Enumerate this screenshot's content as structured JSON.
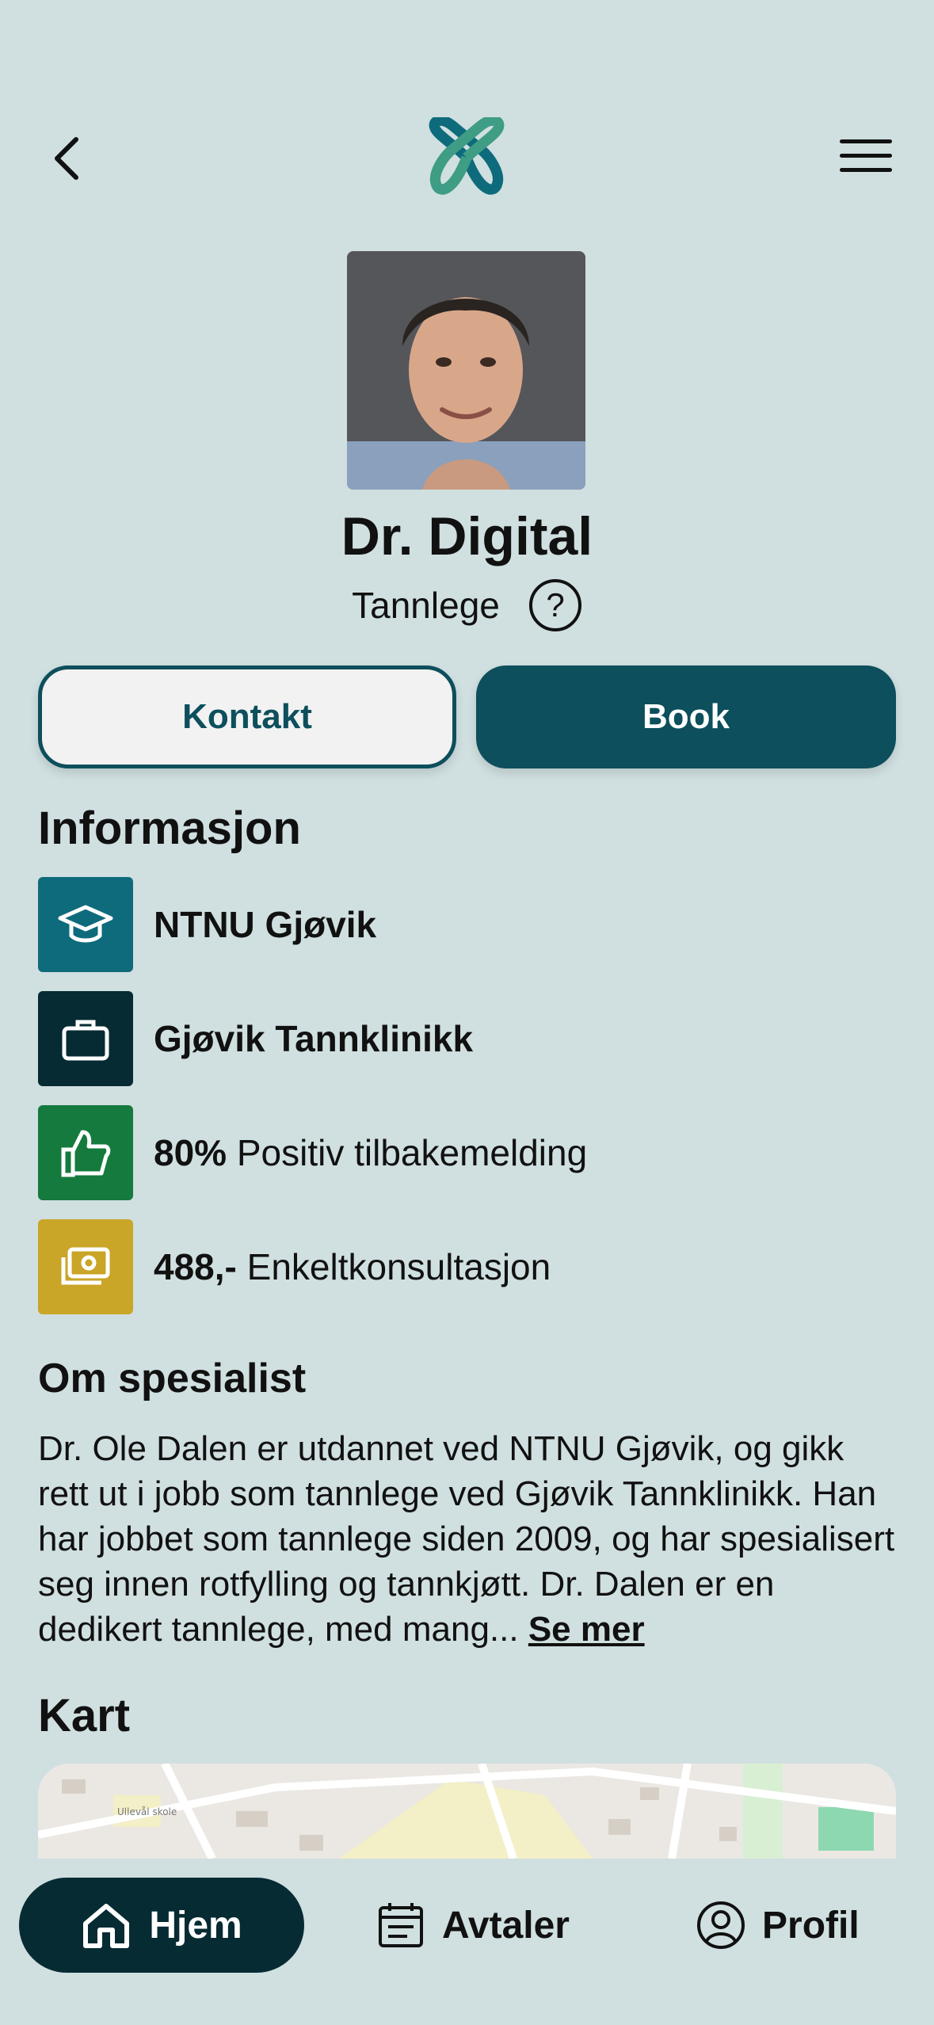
{
  "header": {
    "back_icon": "chevron-left-icon",
    "logo_icon": "medical-cross-logo",
    "menu_icon": "hamburger-menu-icon"
  },
  "profile": {
    "name": "Dr. Digital",
    "role": "Tannlege",
    "help_icon": "question-circle-icon"
  },
  "actions": {
    "contact_label": "Kontakt",
    "book_label": "Book"
  },
  "info": {
    "title": "Informasjon",
    "items": [
      {
        "bold": "NTNU Gjøvik",
        "text": "",
        "icon": "graduation-cap-icon",
        "color": "#0e6b7c"
      },
      {
        "bold": "Gjøvik Tannklinikk",
        "text": "",
        "icon": "briefcase-icon",
        "color": "#062b33"
      },
      {
        "bold": "80%",
        "text": " Positiv tilbakemelding",
        "icon": "thumbs-up-icon",
        "color": "#147a3d"
      },
      {
        "bold": "488,-",
        "text": " Enkeltkonsultasjon",
        "icon": "money-icon",
        "color": "#c9a528"
      }
    ]
  },
  "about": {
    "title": "Om spesialist",
    "text": "Dr. Ole Dalen er utdannet ved NTNU Gjøvik, og gikk rett ut i jobb som tannlege ved Gjøvik Tannklinikk. Han har jobbet som tannlege siden 2009, og har spesialisert seg innen rotfylling og tannkjøtt. Dr. Dalen er en dedikert tannlege, med mang...",
    "more_label": "Se mer"
  },
  "map": {
    "title": "Kart",
    "label": "Ullevål skole"
  },
  "nav": {
    "home_label": "Hjem",
    "home_icon": "home-icon",
    "appointments_label": "Avtaler",
    "appointments_icon": "calendar-icon",
    "profile_label": "Profil",
    "profile_icon": "user-circle-icon"
  },
  "colors": {
    "background": "#d0dfe0",
    "primary": "#0d4f5c",
    "dark": "#062b33"
  }
}
